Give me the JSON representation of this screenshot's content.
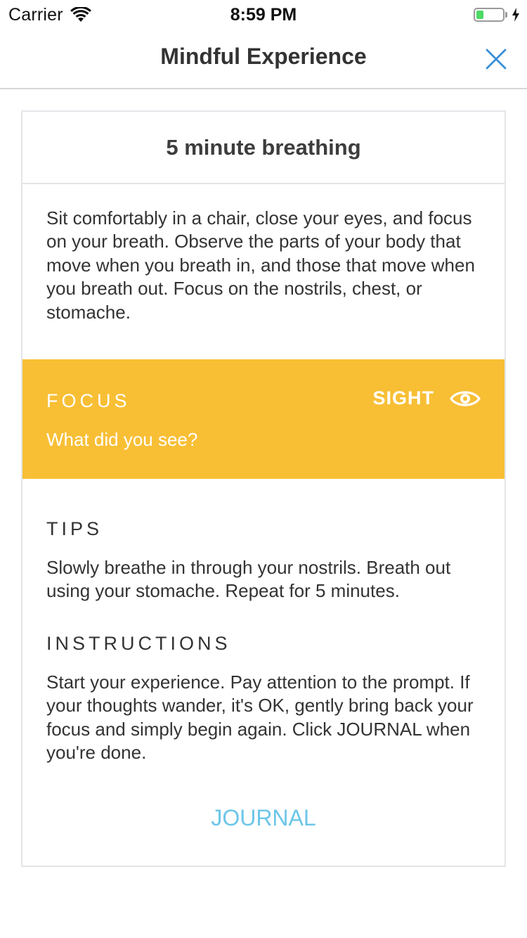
{
  "status_bar": {
    "carrier": "Carrier",
    "time": "8:59 PM",
    "battery_level": 0.35,
    "battery_color": "#4cd964",
    "icons": [
      "wifi-icon",
      "battery-icon",
      "charging-bolt-icon"
    ]
  },
  "navbar": {
    "title": "Mindful Experience",
    "close_icon": "close-icon",
    "accent_color": "#3a8fd8"
  },
  "card": {
    "title": "5 minute breathing",
    "description": "Sit comfortably in a chair, close your eyes, and focus on your breath. Observe the parts of your body that move when you breath in, and those that move when you breath out. Focus on the nostrils, chest, or stomache.",
    "focus": {
      "label": "FOCUS",
      "question": "What did you see?",
      "sense_label": "SIGHT",
      "sense_icon": "eye-icon",
      "background_color": "#f8bf35"
    },
    "tips": {
      "heading": "TIPS",
      "body": "Slowly breathe in through your nostrils. Breath out using your stomache. Repeat for 5 minutes."
    },
    "instructions": {
      "heading": "INSTRUCTIONS",
      "body": "Start your experience. Pay attention to the prompt. If your thoughts wander, it's OK, gently bring back your focus and simply begin again. Click JOURNAL when you're done."
    },
    "journal_label": "JOURNAL",
    "journal_color": "#6cc6e8"
  }
}
